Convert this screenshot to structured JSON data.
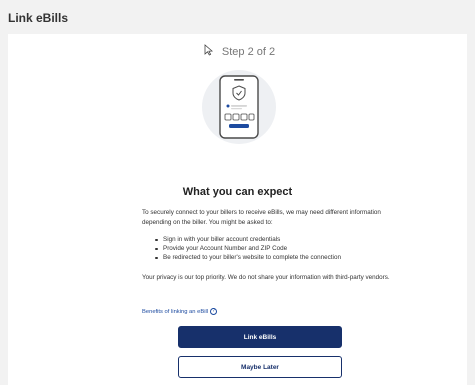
{
  "header": {
    "title": "Link eBills"
  },
  "step": {
    "label": "Step 2 of 2"
  },
  "content": {
    "heading": "What you can expect",
    "intro": "To securely connect to your billers to receive eBills, we may need different information depending on the biller. You might be asked to:",
    "bullets": [
      "Sign in with your biller account credentials",
      "Provide your Account Number and ZIP Code",
      "Be redirected to your biller's website to complete the connection"
    ],
    "privacy": "Your privacy is our top priority. We do not share your information with third-party vendors.",
    "benefits_link": "Benefits of linking an eBill",
    "help_symbol": "?"
  },
  "buttons": {
    "primary": "Link eBills",
    "secondary": "Maybe Later"
  },
  "colors": {
    "primary": "#17306b",
    "link": "#1d4ba0",
    "background": "#f2f2f2",
    "card": "#ffffff"
  },
  "icons": {
    "cursor": "cursor-arrow-icon",
    "illustration": "phone-shield-illustration",
    "help": "help-circle-icon"
  }
}
